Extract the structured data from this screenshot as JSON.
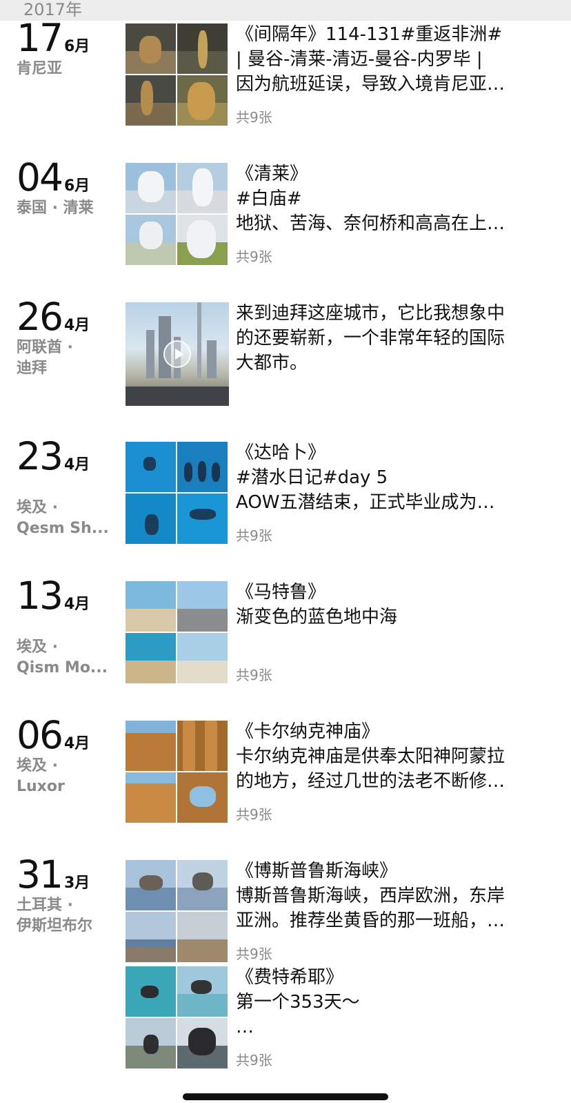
{
  "year_header": "2017年",
  "entries": [
    {
      "day": "17",
      "month": "6月",
      "location": "肯尼亚",
      "lines": [
        "《间隔年》114-131#重返非洲#",
        "| 曼谷-清莱-清迈-曼谷-内罗毕 |",
        "因为航班延误，导致入境肯尼亚…"
      ],
      "count": "共9张",
      "thumbs": [
        "#8c7a5a",
        "#5a5a48",
        "#6e6a5a",
        "#9a8c52"
      ],
      "thumb_names": [
        "lion-photo",
        "giraffe-window-photo",
        "giraffe-photo",
        "giraffe-closeup-photo"
      ]
    },
    {
      "day": "04",
      "month": "6月",
      "location": "泰国 · 清莱",
      "lines": [
        "《清莱》",
        "#白庙#",
        "地狱、苦海、奈何桥和高高在上…"
      ],
      "count": "共9张",
      "thumbs": [
        "#c9d6df",
        "#d7dbe0",
        "#cfd5d8",
        "#dfe3e6"
      ],
      "thumb_names": [
        "white-temple-photo",
        "white-temple-spire-photo",
        "white-temple-reflection-photo",
        "white-statue-photo"
      ]
    },
    {
      "day": "26",
      "month": "4月",
      "location": "阿联酋 ·\n迪拜",
      "lines": [
        "来到迪拜这座城市，它比我想象中",
        "的还要崭新，一个非常年轻的国际",
        "大都市。"
      ],
      "count": ""
    },
    {
      "day": "23",
      "month": "4月",
      "location": "埃及 ·\nQesm Sh...",
      "lines": [
        "《达哈卜》",
        "#潜水日记#day 5",
        "AOW五潜结束，正式毕业成为…"
      ],
      "count": "共9张",
      "thumbs": [
        "#1c8fd0",
        "#1a7fbf",
        "#1588c8",
        "#1a95d6"
      ],
      "thumb_names": [
        "diver-photo-1",
        "diver-group-photo",
        "diver-photo-2",
        "diver-photo-3"
      ]
    },
    {
      "day": "13",
      "month": "4月",
      "location": "埃及 ·\nQism Mo...",
      "lines": [
        "《马特鲁》",
        "渐变色的蓝色地中海",
        ""
      ],
      "count": "共9张",
      "thumbs": [
        "#3aa3c9",
        "#5bb0d4",
        "#2d9cc4",
        "#48a8cf"
      ],
      "thumb_names": [
        "sea-coast-photo",
        "sea-road-photo",
        "sea-cliff-photo",
        "sea-beach-photo"
      ]
    },
    {
      "day": "06",
      "month": "4月",
      "location": "埃及 ·\nLuxor",
      "lines": [
        "《卡尔纳克神庙》",
        "卡尔纳克神庙是供奉太阳神阿蒙拉",
        "的地方，经过几世的法老不断修…"
      ],
      "count": "共9张",
      "thumbs": [
        "#b87a36",
        "#a36a2c",
        "#c88a42",
        "#b07436"
      ],
      "thumb_names": [
        "temple-gate-photo",
        "temple-columns-photo",
        "temple-pillars-photo",
        "temple-arch-photo"
      ]
    },
    {
      "day": "31",
      "month": "3月",
      "location": "土耳其 ·\n伊斯坦布尔",
      "lines": [
        "《博斯普鲁斯海峡》",
        "博斯普鲁斯海峡，西岸欧洲，东岸",
        "亚洲。推荐坐黄昏的那一班船，…"
      ],
      "count": "共9张",
      "thumbs": [
        "#6f8fb0",
        "#8ba3bd",
        "#5f7fa3",
        "#98a2a8"
      ],
      "thumb_names": [
        "mosque-photo",
        "mosque-waterfront-photo",
        "city-shore-photo",
        "city-hill-photo"
      ]
    },
    {
      "day": "",
      "month": "",
      "location": "",
      "lines": [
        "《费特希耶》",
        "第一个353天～",
        "…"
      ],
      "count": "共9张",
      "thumbs": [
        "#3aa6b8",
        "#6fb6c8",
        "#7d8a7a",
        "#5b6a6e"
      ],
      "thumb_names": [
        "paraglide-photo-1",
        "paraglide-photo-2",
        "paraglide-photo-3",
        "paraglide-photo-4"
      ]
    }
  ]
}
